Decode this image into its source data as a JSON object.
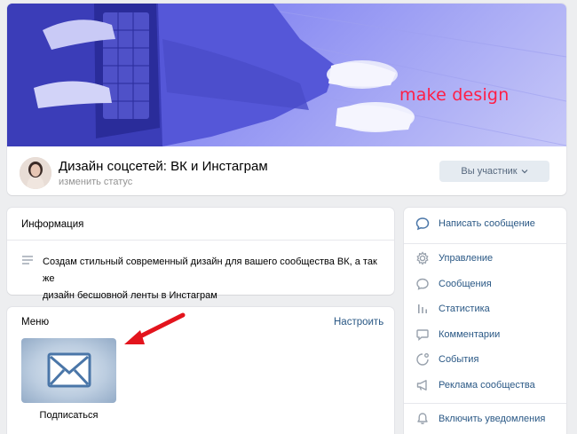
{
  "cover": {
    "text": "make design"
  },
  "group": {
    "title": "Дизайн соцсетей: ВК и Инстаграм",
    "status": "изменить статус",
    "member_button": "Вы участник"
  },
  "info": {
    "title": "Информация",
    "description_line1": "Создам стильный современный дизайн для вашего сообщества ВК, а так же",
    "description_line2": "дизайн бесшовной ленты в Инстаграм"
  },
  "menu": {
    "title": "Меню",
    "configure": "Настроить",
    "items": [
      {
        "label": "Подписаться",
        "icon": "envelope-icon"
      }
    ]
  },
  "sidebar": {
    "primary": {
      "label": "Написать сообщение",
      "icon": "message-bubble-icon"
    },
    "items": [
      {
        "label": "Управление",
        "icon": "gear-icon"
      },
      {
        "label": "Сообщения",
        "icon": "chat-bubble-icon"
      },
      {
        "label": "Статистика",
        "icon": "bar-chart-icon"
      },
      {
        "label": "Комментарии",
        "icon": "comment-icon"
      },
      {
        "label": "События",
        "icon": "event-icon"
      },
      {
        "label": "Реклама сообщества",
        "icon": "megaphone-icon"
      }
    ],
    "notify": {
      "label": "Включить уведомления",
      "icon": "bell-icon"
    }
  },
  "colors": {
    "link": "#2a5885",
    "accent": "#4a76a8",
    "cover_text": "#ff1e46",
    "background": "#edeef0"
  }
}
